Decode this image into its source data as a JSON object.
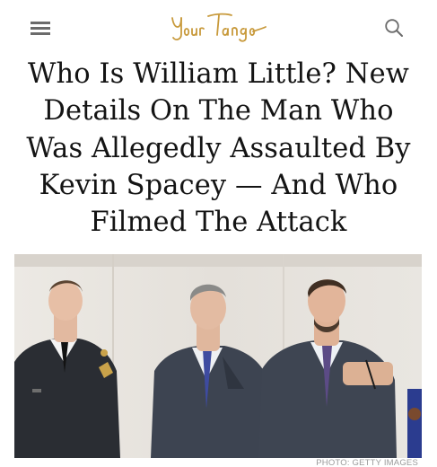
{
  "header": {
    "logo_text": "YourTango",
    "logo_color": "#c89a3c",
    "menu_icon": "hamburger-menu-icon",
    "search_icon": "search-icon"
  },
  "article": {
    "title": "Who Is William Little? New Details On The Man Who Was Allegedly Assaulted By Kevin Spacey — And Who Filmed The Attack"
  },
  "hero_image": {
    "credit": "PHOTO: GETTY IMAGES"
  }
}
